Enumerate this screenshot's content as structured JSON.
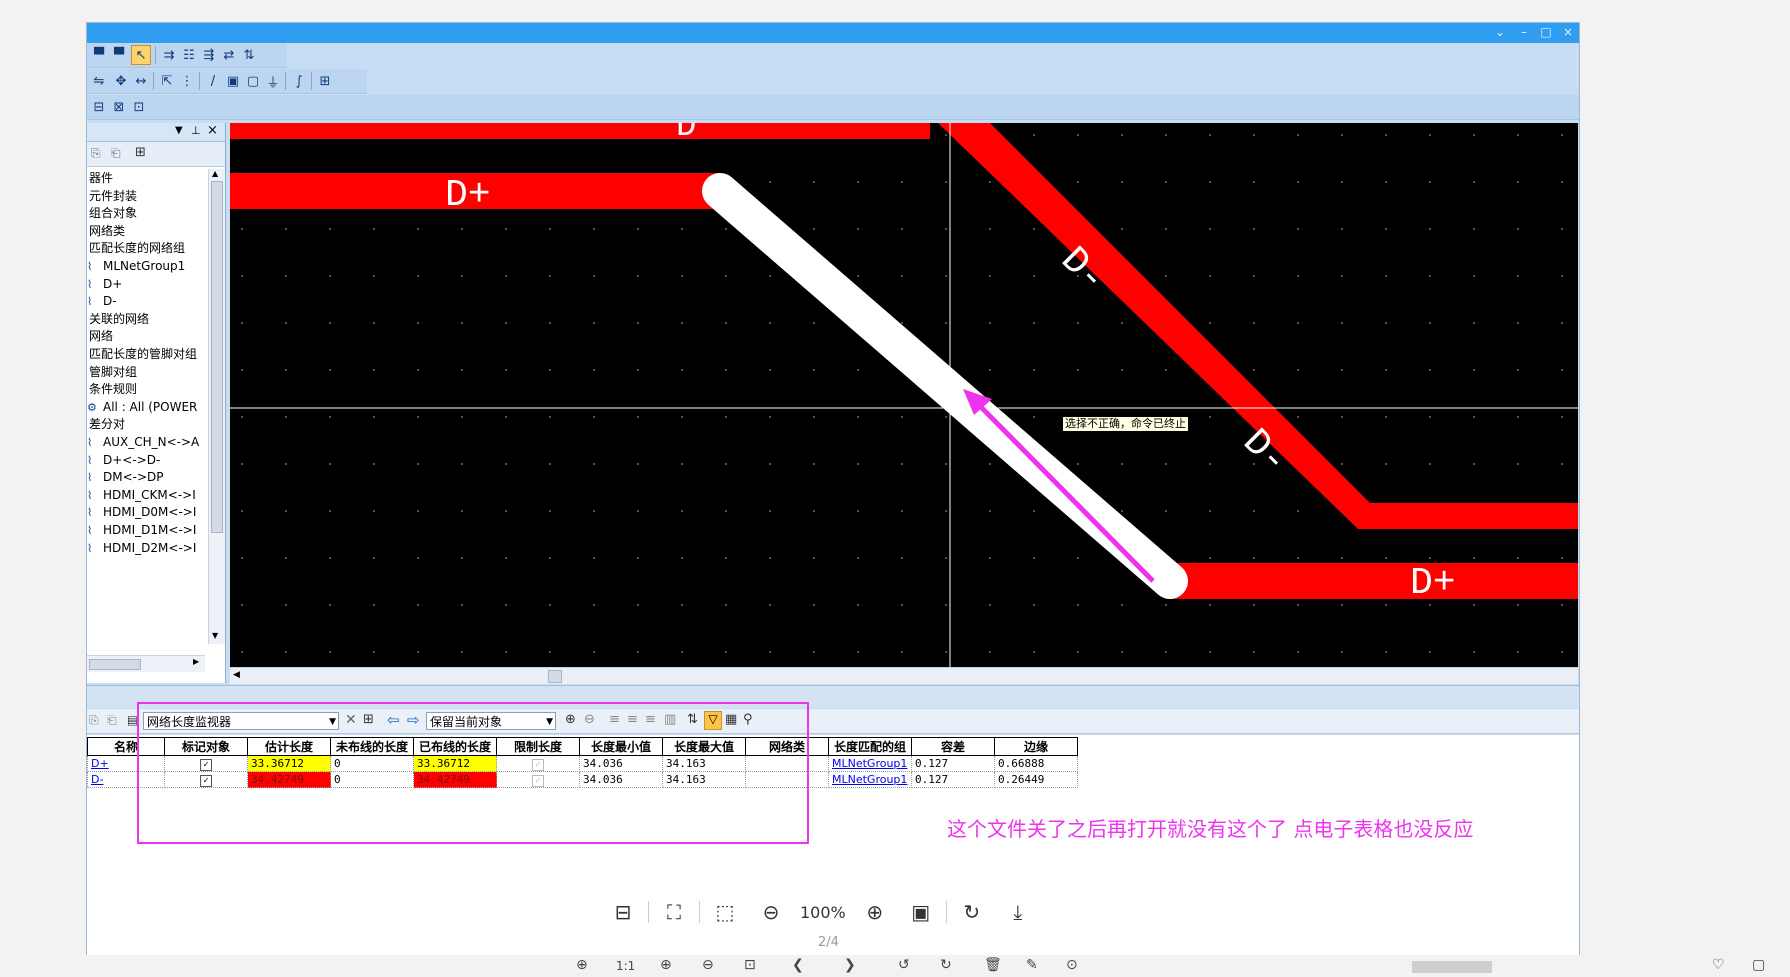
{
  "sidebar": {
    "items": [
      {
        "label": "器件",
        "icon": ""
      },
      {
        "label": "元件封装",
        "icon": ""
      },
      {
        "label": "组合对象",
        "icon": ""
      },
      {
        "label": "网络类",
        "icon": ""
      },
      {
        "label": "匹配长度的网络组",
        "icon": ""
      },
      {
        "label": "MLNetGroup1",
        "icon": "net-group-icon"
      },
      {
        "label": "D+",
        "icon": "net-icon"
      },
      {
        "label": "D-",
        "icon": "net-icon"
      },
      {
        "label": "关联的网络",
        "icon": ""
      },
      {
        "label": "网络",
        "icon": ""
      },
      {
        "label": "匹配长度的管脚对组",
        "icon": ""
      },
      {
        "label": "管脚对组",
        "icon": ""
      },
      {
        "label": "条件规则",
        "icon": ""
      },
      {
        "label": "All : All (POWER",
        "icon": "rule-icon"
      },
      {
        "label": "差分对",
        "icon": ""
      },
      {
        "label": "AUX_CH_N<->A",
        "icon": "diff-pair-icon"
      },
      {
        "label": "D+<->D-",
        "icon": "diff-pair-icon"
      },
      {
        "label": "DM<->DP",
        "icon": "diff-pair-icon"
      },
      {
        "label": "HDMI_CKM<->I",
        "icon": "diff-pair-icon"
      },
      {
        "label": "HDMI_D0M<->I",
        "icon": "diff-pair-icon"
      },
      {
        "label": "HDMI_D1M<->I",
        "icon": "diff-pair-icon"
      },
      {
        "label": "HDMI_D2M<->I",
        "icon": "diff-pair-icon"
      }
    ]
  },
  "canvas": {
    "labels": {
      "top_d": "D",
      "d_plus_left": "D+",
      "d_minus_upper": "D-",
      "d_minus_lower": "D-",
      "d_plus_right": "D+"
    },
    "tooltip": "选择不正确，命令已终止",
    "colors": {
      "trace": "#ff0000",
      "selected_trace": "#ffffff",
      "background": "#000000",
      "arrow": "#ee33ee"
    }
  },
  "length_monitor": {
    "panel_combo": "网络长度监视器",
    "keep_combo": "保留当前对象",
    "columns": [
      "名称",
      "标记对象",
      "估计长度",
      "未布线的长度",
      "已布线的长度",
      "限制长度",
      "长度最小值",
      "长度最大值",
      "网络类",
      "长度匹配的组",
      "容差",
      "边缘"
    ],
    "rows": [
      {
        "name": "D+",
        "marked": "✓",
        "estimated": "33.36712",
        "unrouted": "0",
        "routed": "33.36712",
        "limit": "✓",
        "min": "34.036",
        "max": "34.163",
        "net_class": "",
        "group": "MLNetGroup1",
        "tolerance": "0.127",
        "margin": "0.66888",
        "status_color": "#ffff00"
      },
      {
        "name": "D-",
        "marked": "✓",
        "estimated": "34.42749",
        "unrouted": "0",
        "routed": "34.42749",
        "limit": "✓",
        "min": "34.036",
        "max": "34.163",
        "net_class": "",
        "group": "MLNetGroup1",
        "tolerance": "0.127",
        "margin": "0.26449",
        "status_color": "#ff0000"
      }
    ]
  },
  "annotation": "这个文件关了之后再打开就没有这个了  点电子表格也没反应",
  "viewer": {
    "zoom": "100%",
    "page": "2/4",
    "bottom_ratio": "1:1"
  }
}
